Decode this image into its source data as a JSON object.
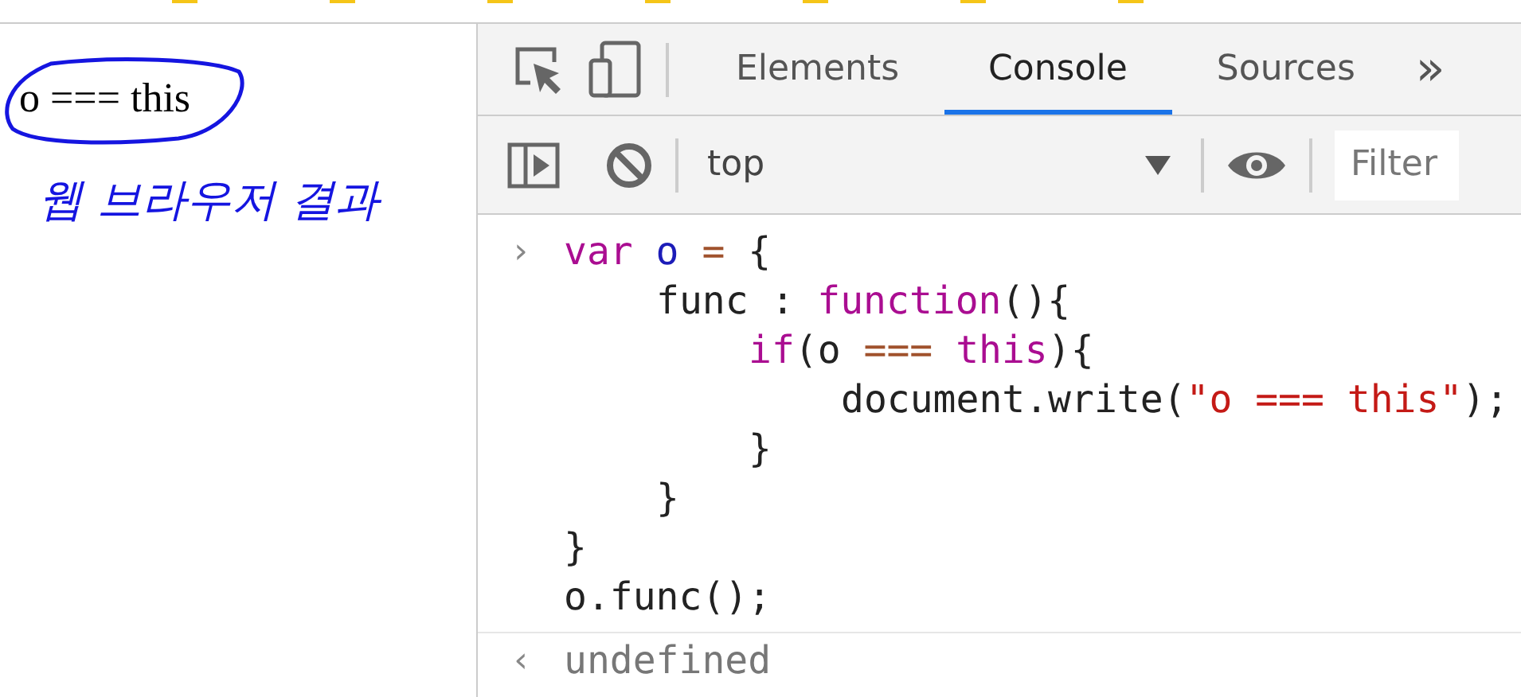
{
  "page": {
    "output": "o === this",
    "annotation": "웹 브라우저 결과"
  },
  "devtools": {
    "tabs": [
      {
        "label": "Elements",
        "selected": false
      },
      {
        "label": "Console",
        "selected": true
      },
      {
        "label": "Sources",
        "selected": false
      }
    ],
    "more": "»",
    "context": {
      "value": "top"
    },
    "filter": {
      "placeholder": "Filter"
    },
    "entries": [
      {
        "kind": "input",
        "prompt": "›",
        "lines": [
          {
            "tokens": [
              {
                "text": "var",
                "kind": "keyword"
              },
              {
                "text": " o ",
                "kind": "variable"
              },
              {
                "text": "=",
                "kind": "operator"
              },
              {
                "text": " {",
                "kind": "plain"
              }
            ],
            "children": [
              {
                "tokens": [
                  {
                    "text": "func : ",
                    "kind": "plain"
                  },
                  {
                    "text": "function",
                    "kind": "keyword"
                  },
                  {
                    "text": "(){",
                    "kind": "plain"
                  }
                ],
                "children": [
                  {
                    "tokens": [
                      {
                        "text": "if",
                        "kind": "keyword"
                      },
                      {
                        "text": "(o ",
                        "kind": "plain"
                      },
                      {
                        "text": "===",
                        "kind": "operator"
                      },
                      {
                        "text": " this",
                        "kind": "keyword"
                      },
                      {
                        "text": "){",
                        "kind": "plain"
                      }
                    ],
                    "children": [
                      {
                        "tokens": [
                          {
                            "text": "document.write(",
                            "kind": "plain"
                          },
                          {
                            "text": "\"o === this\"",
                            "kind": "string"
                          },
                          {
                            "text": ");",
                            "kind": "plain"
                          }
                        ]
                      }
                    ]
                  },
                  {
                    "tokens": [
                      {
                        "text": "}",
                        "kind": "plain"
                      }
                    ]
                  }
                ]
              },
              {
                "tokens": [
                  {
                    "text": "}",
                    "kind": "plain"
                  }
                ]
              }
            ]
          },
          {
            "tokens": [
              {
                "text": "}",
                "kind": "plain"
              }
            ]
          },
          {
            "tokens": [
              {
                "text": "o.func();",
                "kind": "plain"
              }
            ]
          }
        ]
      },
      {
        "kind": "result",
        "prompt": "‹",
        "text": "undefined"
      }
    ]
  }
}
